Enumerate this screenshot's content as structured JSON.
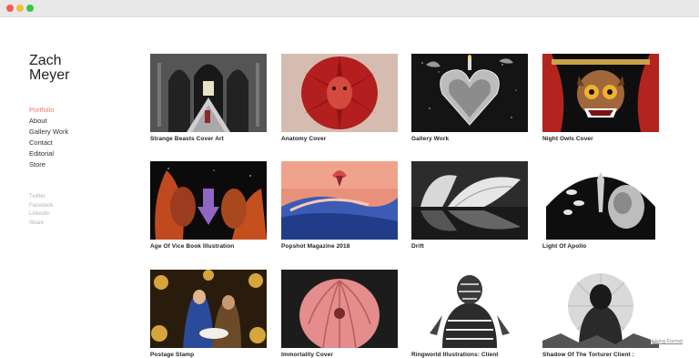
{
  "site": {
    "name_line1": "Zach",
    "name_line2": "Meyer"
  },
  "nav": {
    "items": [
      {
        "label": "Portfolio",
        "active": true
      },
      {
        "label": "About"
      },
      {
        "label": "Gallery Work"
      },
      {
        "label": "Contact"
      },
      {
        "label": "Editorial"
      },
      {
        "label": "Store"
      }
    ]
  },
  "social": {
    "items": [
      "Twitter",
      "Facebook",
      "LinkedIn",
      "Share"
    ]
  },
  "portfolio": {
    "items": [
      {
        "title": "Strange Beasts Cover Art"
      },
      {
        "title": "Anatomy Cover"
      },
      {
        "title": "Gallery Work"
      },
      {
        "title": "Night Owls Cover"
      },
      {
        "title": "Age Of Vice Book Illustration"
      },
      {
        "title": "Popshot Magazine 2018"
      },
      {
        "title": "Drift"
      },
      {
        "title": "Light Of Apollo"
      },
      {
        "title": "Postage Stamp"
      },
      {
        "title": "Immortality Cover"
      },
      {
        "title": "Ringworld Illustrations: Client"
      },
      {
        "title": "Shadow Of The Torturer Client :"
      }
    ]
  },
  "badge": {
    "label": "Using Format"
  }
}
